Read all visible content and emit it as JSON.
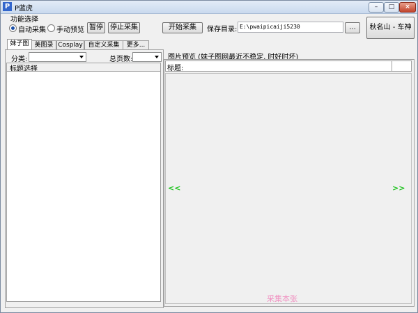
{
  "window": {
    "title": "P蓝虎"
  },
  "function_group": {
    "title": "功能选择",
    "auto_label": "自动采集",
    "manual_label": "手动预览",
    "pause_label": "暂停",
    "stop_label": "停止采集"
  },
  "top": {
    "start_label": "开始采集",
    "save_dir_label": "保存目录:",
    "save_dir_value": "E:\\pwaipicaiji5230",
    "browse_label": "...",
    "credit_label": "秋名山 - 车神"
  },
  "tabs": [
    "妹子图",
    "美图录",
    "Cosplay",
    "自定义采集",
    "更多..."
  ],
  "left": {
    "category_label": "分类:",
    "total_pages_label": "总页数:",
    "title_select_label": "标题选择"
  },
  "right": {
    "preview_title": "图片预览 (妹子图网最近不稳定, 时好时坏)",
    "title_label": "标题:",
    "prev_label": "<<",
    "next_label": ">>",
    "collect_label": "采集本张"
  }
}
